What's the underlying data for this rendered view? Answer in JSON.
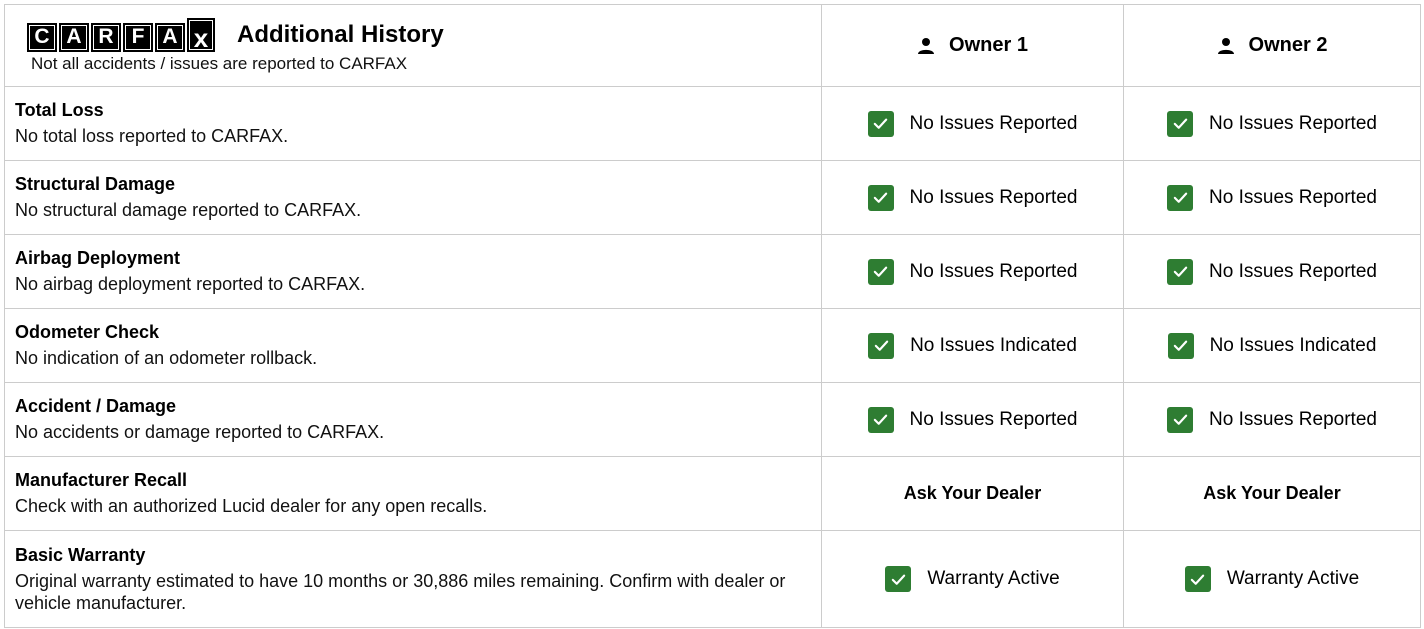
{
  "header": {
    "logo_letters": [
      "C",
      "A",
      "R",
      "F",
      "A",
      "x"
    ],
    "title": "Additional History",
    "subtitle": "Not all accidents / issues are reported to CARFAX",
    "owners": [
      "Owner 1",
      "Owner 2"
    ]
  },
  "colors": {
    "check_green": "#2e7d32",
    "border": "#cccccc"
  },
  "rows": [
    {
      "title": "Total Loss",
      "description": "No total loss reported to CARFAX.",
      "owner1": {
        "status": "No Issues Reported",
        "icon": "check-icon"
      },
      "owner2": {
        "status": "No Issues Reported",
        "icon": "check-icon"
      }
    },
    {
      "title": "Structural Damage",
      "description": "No structural damage reported to CARFAX.",
      "owner1": {
        "status": "No Issues Reported",
        "icon": "check-icon"
      },
      "owner2": {
        "status": "No Issues Reported",
        "icon": "check-icon"
      }
    },
    {
      "title": "Airbag Deployment",
      "description": "No airbag deployment reported to CARFAX.",
      "owner1": {
        "status": "No Issues Reported",
        "icon": "check-icon"
      },
      "owner2": {
        "status": "No Issues Reported",
        "icon": "check-icon"
      }
    },
    {
      "title": "Odometer Check",
      "description": "No indication of an odometer rollback.",
      "owner1": {
        "status": "No Issues Indicated",
        "icon": "check-icon"
      },
      "owner2": {
        "status": "No Issues Indicated",
        "icon": "check-icon"
      }
    },
    {
      "title": "Accident / Damage",
      "description": "No accidents or damage reported to CARFAX.",
      "owner1": {
        "status": "No Issues Reported",
        "icon": "check-icon"
      },
      "owner2": {
        "status": "No Issues Reported",
        "icon": "check-icon"
      }
    },
    {
      "title": "Manufacturer Recall",
      "description": "Check with an authorized Lucid dealer for any open recalls.",
      "owner1": {
        "status": "Ask Your Dealer",
        "icon": ""
      },
      "owner2": {
        "status": "Ask Your Dealer",
        "icon": ""
      }
    },
    {
      "title": "Basic Warranty",
      "description": "Original warranty estimated to have 10 months or 30,886 miles remaining. Confirm with dealer or vehicle manufacturer.",
      "owner1": {
        "status": "Warranty Active",
        "icon": "check-icon"
      },
      "owner2": {
        "status": "Warranty Active",
        "icon": "check-icon"
      }
    }
  ]
}
